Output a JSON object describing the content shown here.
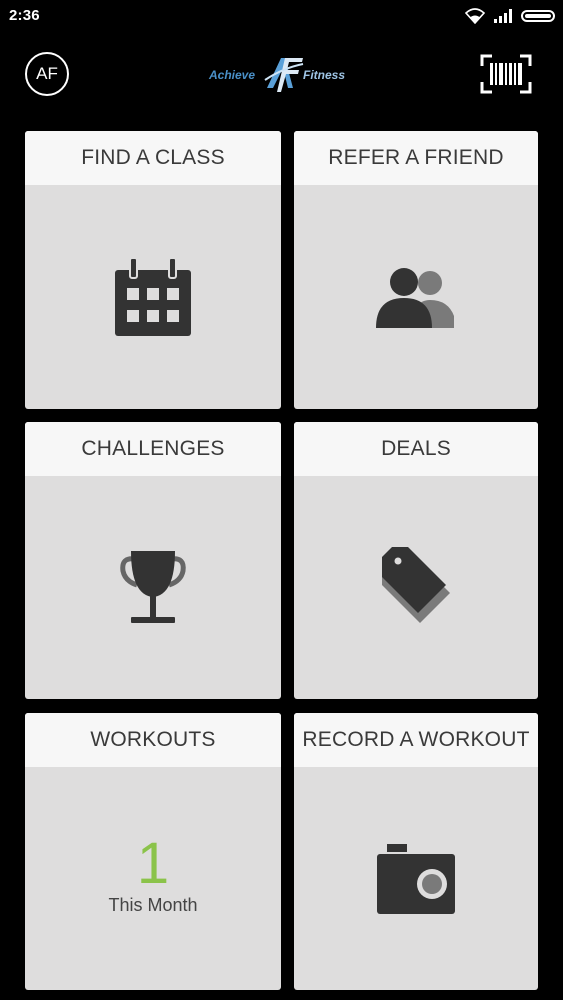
{
  "status_bar": {
    "time": "2:36"
  },
  "header": {
    "avatar_initials": "AF",
    "logo_left": "Achieve",
    "logo_right": "Fitness"
  },
  "tiles": [
    {
      "title": "FIND A CLASS",
      "icon": "calendar-icon"
    },
    {
      "title": "REFER A FRIEND",
      "icon": "people-icon"
    },
    {
      "title": "CHALLENGES",
      "icon": "trophy-icon"
    },
    {
      "title": "DEALS",
      "icon": "tag-icon"
    },
    {
      "title": "WORKOUTS",
      "icon": "",
      "count": "1",
      "count_label": "This Month"
    },
    {
      "title": "RECORD A WORKOUT",
      "icon": "camera-icon"
    }
  ],
  "colors": {
    "background": "#000000",
    "tile_body": "#dedddd",
    "tile_header": "#f7f7f7",
    "icon": "#333333",
    "accent_green": "#8bc34a",
    "logo_blue": "#4a90c8"
  }
}
